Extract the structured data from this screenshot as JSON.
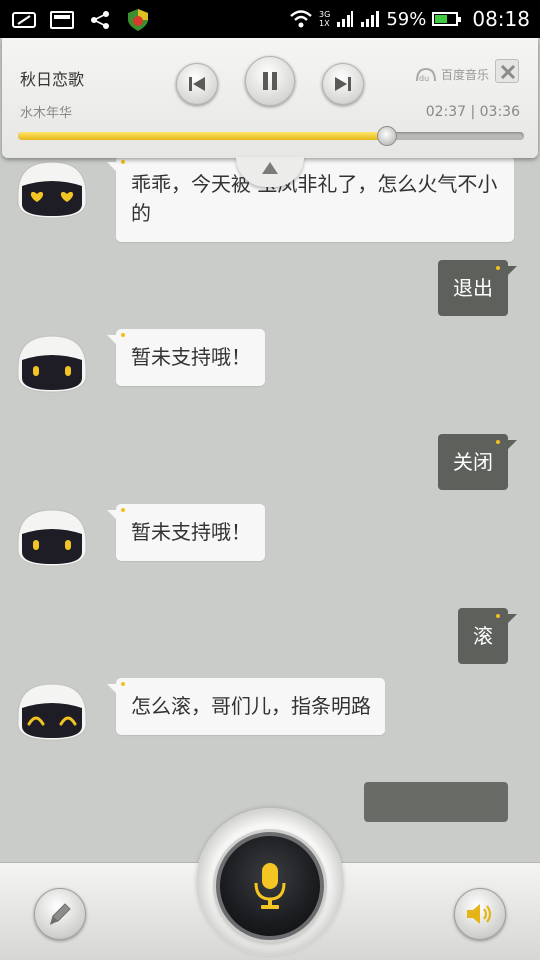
{
  "status_bar": {
    "network_top": "3G",
    "network_bottom": "1X",
    "battery_percent": "59%",
    "battery_level": 0.59,
    "time": "08:18"
  },
  "music": {
    "title": "秋日恋歌",
    "artist": "水木年华",
    "brand": "百度音乐",
    "brand_logo": "du",
    "time_display": "02:37 | 03:36",
    "progress_fraction": 0.73
  },
  "messages": [
    {
      "from": "bot",
      "text": "乖乖，今天被 玉凤非礼了，怎么火气不小的",
      "avatar": "heart-eyes"
    },
    {
      "from": "user",
      "text": "退出"
    },
    {
      "from": "bot",
      "text": "暂未支持哦！",
      "avatar": "dot-eyes"
    },
    {
      "from": "user",
      "text": "关闭"
    },
    {
      "from": "bot",
      "text": "暂未支持哦！",
      "avatar": "dot-eyes"
    },
    {
      "from": "user",
      "text": "滚"
    },
    {
      "from": "bot",
      "text": "怎么滚，哥们儿，指条明路",
      "avatar": "smile-eyes"
    }
  ],
  "icons": {
    "mic": "microphone-icon",
    "edit": "pencil-icon",
    "volume": "speaker-icon"
  },
  "colors": {
    "accent": "#f0c020",
    "user_bubble": "#5d605b",
    "bot_bubble": "#f7f7f7"
  }
}
